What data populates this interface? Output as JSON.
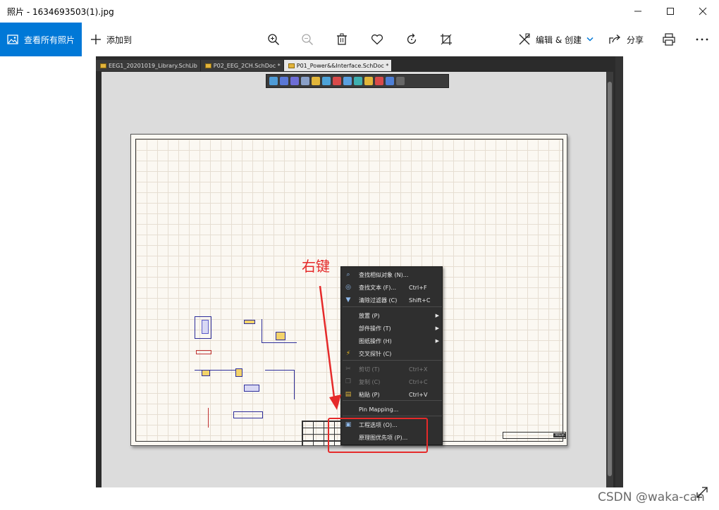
{
  "window": {
    "title": "照片 - 1634693503(1).jpg",
    "controls": [
      "minimize-icon",
      "maximize-icon",
      "close-icon"
    ]
  },
  "toolbar": {
    "view_all_label": "查看所有照片",
    "add_to_label": "添加到",
    "edit_create_label": "编辑 & 创建",
    "share_label": "分享",
    "icons": [
      "zoom-in-icon",
      "zoom-out-icon",
      "delete-icon",
      "favorite-icon",
      "rotate-icon",
      "crop-icon",
      "print-icon",
      "more-icon"
    ]
  },
  "colors": {
    "accent": "#0078d7",
    "annotation_red": "#e52a2a",
    "menu_bg": "#2f2f2f"
  },
  "screenshot": {
    "tabs": [
      {
        "label": "EEG1_20201019_Library.SchLib",
        "active": false
      },
      {
        "label": "P02_EEG_2CH.SchDoc *",
        "active": false
      },
      {
        "label": "P01_Power&&Interface.SchDoc *",
        "active": true
      }
    ],
    "annotation_text": "右键",
    "context_menu": [
      {
        "icon": "search-icon",
        "label": "查找相似对象 (N)...",
        "shortcut": "",
        "submenu": false,
        "enabled": true
      },
      {
        "icon": "binoculars-icon",
        "label": "查找文本 (F)...",
        "shortcut": "Ctrl+F",
        "submenu": false,
        "enabled": true
      },
      {
        "icon": "filter-clear-icon",
        "label": "清除过滤器 (C)",
        "shortcut": "Shift+C",
        "submenu": false,
        "enabled": true
      },
      {
        "icon": "",
        "label": "放置 (P)",
        "shortcut": "",
        "submenu": true,
        "enabled": true
      },
      {
        "icon": "",
        "label": "部件操作 (T)",
        "shortcut": "",
        "submenu": true,
        "enabled": true
      },
      {
        "icon": "",
        "label": "图纸操作 (H)",
        "shortcut": "",
        "submenu": true,
        "enabled": true
      },
      {
        "icon": "cross-probe-icon",
        "label": "交叉探针 (C)",
        "shortcut": "",
        "submenu": false,
        "enabled": true
      },
      {
        "icon": "cut-icon",
        "label": "剪切 (T)",
        "shortcut": "Ctrl+X",
        "submenu": false,
        "enabled": false
      },
      {
        "icon": "copy-icon",
        "label": "复制 (C)",
        "shortcut": "Ctrl+C",
        "submenu": false,
        "enabled": false
      },
      {
        "icon": "paste-icon",
        "label": "粘贴 (P)",
        "shortcut": "Ctrl+V",
        "submenu": false,
        "enabled": true
      },
      {
        "icon": "",
        "label": "Pin Mapping...",
        "shortcut": "",
        "submenu": false,
        "enabled": true
      },
      {
        "icon": "project-options-icon",
        "label": "工程选项 (O)...",
        "shortcut": "",
        "submenu": false,
        "enabled": true
      },
      {
        "icon": "",
        "label": "原理图优先项 (P)...",
        "shortcut": "",
        "submenu": false,
        "enabled": true
      }
    ],
    "title_block_logo": "Altium"
  },
  "watermark": "CSDN @waka-can"
}
